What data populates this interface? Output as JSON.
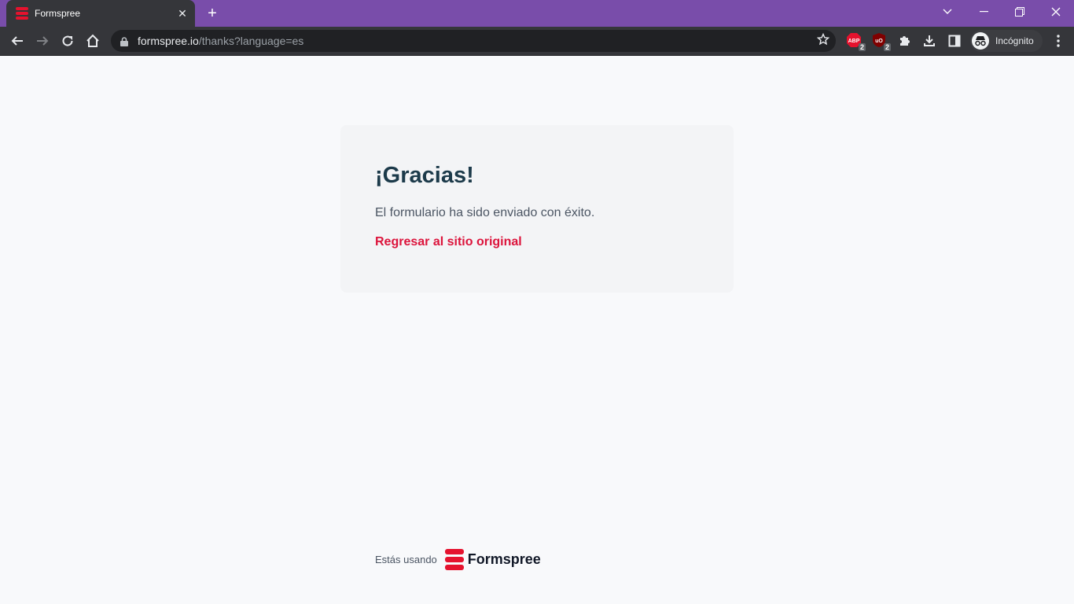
{
  "browser": {
    "tab_title": "Formspree",
    "url_host": "formspree.io",
    "url_path": "/thanks?language=es",
    "profile_label": "Incógnito",
    "extensions": [
      {
        "name": "ABP",
        "badge": "2"
      },
      {
        "name": "uBlock",
        "badge": "2"
      }
    ]
  },
  "page": {
    "heading": "¡Gracias!",
    "message": "El formulario ha sido enviado con éxito.",
    "return_link": "Regresar al sitio original"
  },
  "footer": {
    "using_text": "Estás usando",
    "brand_name": "Formspree"
  },
  "colors": {
    "titlebar": "#794daa",
    "accent": "#dc143c",
    "brand": "#e5122e"
  }
}
